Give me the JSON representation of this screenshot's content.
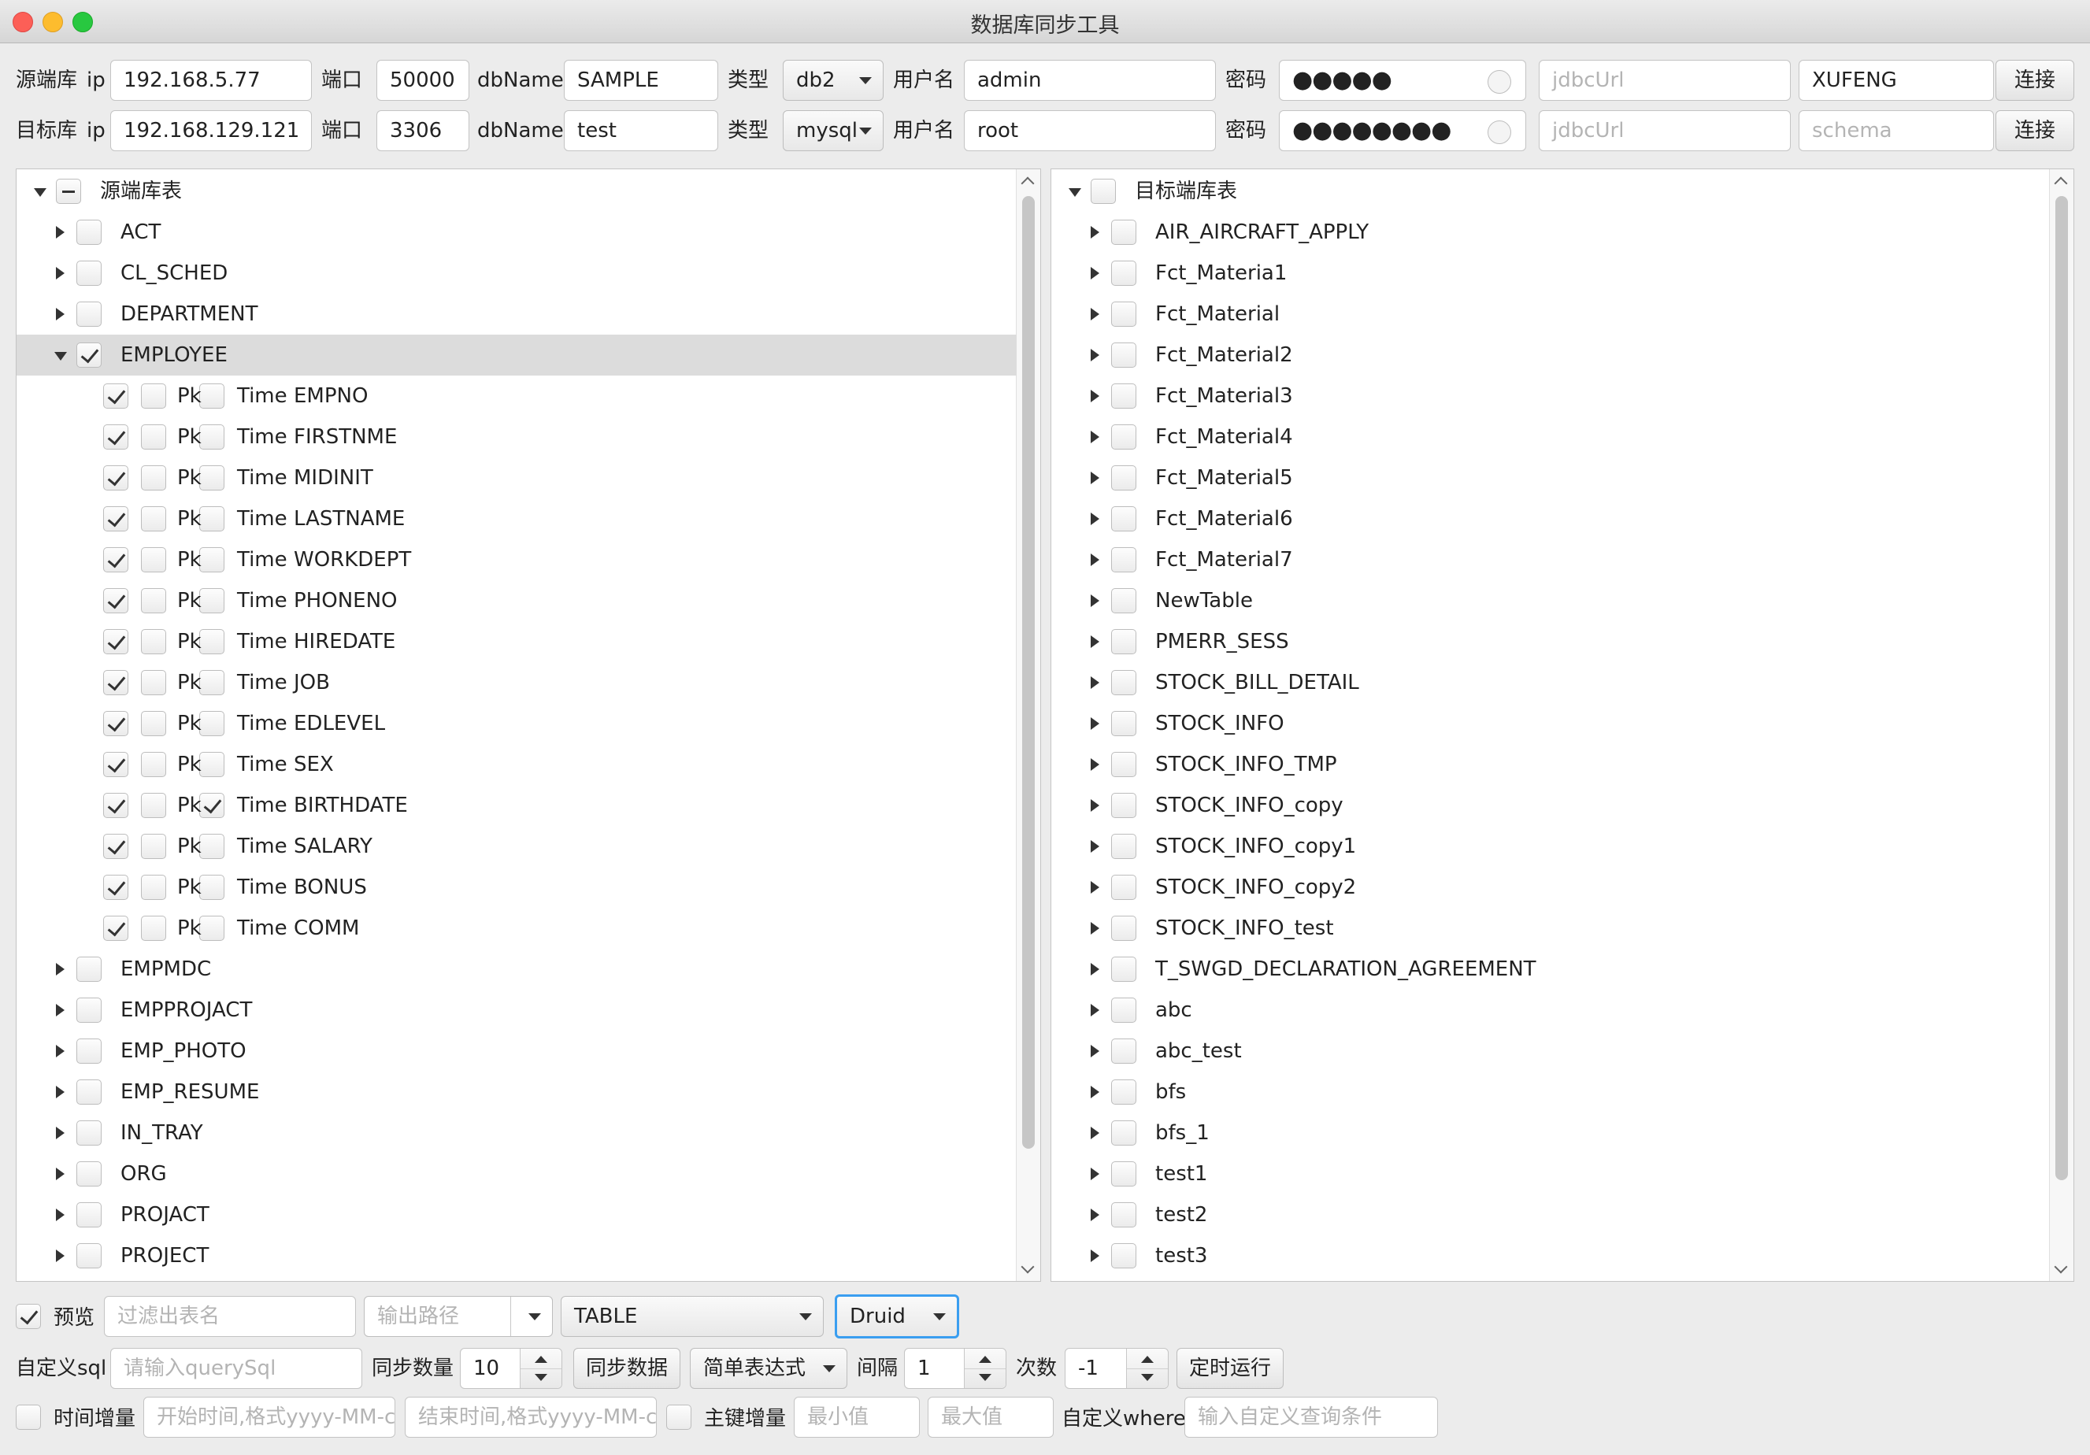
{
  "window": {
    "title": "数据库同步工具"
  },
  "source": {
    "label": "源端库",
    "ip_label": "ip",
    "ip": "192.168.5.77",
    "port_label": "端口",
    "port": "50000",
    "dbname_label": "dbName",
    "dbname": "SAMPLE",
    "type_label": "类型",
    "type": "db2",
    "user_label": "用户名",
    "user": "admin",
    "pwd_label": "密码",
    "pwd": "●●●●●",
    "jdbc_placeholder": "jdbcUrl",
    "schema": "XUFENG",
    "connect_label": "连接"
  },
  "target": {
    "label": "目标库",
    "ip_label": "ip",
    "ip": "192.168.129.121",
    "port_label": "端口",
    "port": "3306",
    "dbname_label": "dbName",
    "dbname": "test",
    "type_label": "类型",
    "type": "mysql",
    "user_label": "用户名",
    "user": "root",
    "pwd_label": "密码",
    "pwd": "●●●●●●●●",
    "jdbc_placeholder": "jdbcUrl",
    "schema_placeholder": "schema",
    "connect_label": "连接"
  },
  "source_tree": {
    "root_label": "源端库表",
    "tables_before": [
      "ACT",
      "CL_SCHED",
      "DEPARTMENT"
    ],
    "expanded_table": "EMPLOYEE",
    "column_pk_label": "Pk",
    "column_time_label": "Time",
    "columns": [
      {
        "name": "EMPNO",
        "time": false
      },
      {
        "name": "FIRSTNME",
        "time": false
      },
      {
        "name": "MIDINIT",
        "time": false
      },
      {
        "name": "LASTNAME",
        "time": false
      },
      {
        "name": "WORKDEPT",
        "time": false
      },
      {
        "name": "PHONENO",
        "time": false
      },
      {
        "name": "HIREDATE",
        "time": false
      },
      {
        "name": "JOB",
        "time": false
      },
      {
        "name": "EDLEVEL",
        "time": false
      },
      {
        "name": "SEX",
        "time": false
      },
      {
        "name": "BIRTHDATE",
        "time": true
      },
      {
        "name": "SALARY",
        "time": false
      },
      {
        "name": "BONUS",
        "time": false
      },
      {
        "name": "COMM",
        "time": false
      }
    ],
    "tables_after": [
      "EMPMDC",
      "EMPPROJACT",
      "EMP_PHOTO",
      "EMP_RESUME",
      "IN_TRAY",
      "ORG",
      "PROJACT",
      "PROJECT"
    ]
  },
  "target_tree": {
    "root_label": "目标端库表",
    "tables": [
      "AIR_AIRCRAFT_APPLY",
      "Fct_Materia1",
      "Fct_Material",
      "Fct_Material2",
      "Fct_Material3",
      "Fct_Material4",
      "Fct_Material5",
      "Fct_Material6",
      "Fct_Material7",
      "NewTable",
      "PMERR_SESS",
      "STOCK_BILL_DETAIL",
      "STOCK_INFO",
      "STOCK_INFO_TMP",
      "STOCK_INFO_copy",
      "STOCK_INFO_copy1",
      "STOCK_INFO_copy2",
      "STOCK_INFO_test",
      "T_SWGD_DECLARATION_AGREEMENT",
      "abc",
      "abc_test",
      "bfs",
      "bfs_1",
      "test1",
      "test2",
      "test3"
    ]
  },
  "bottom": {
    "preview_label": "预览",
    "filter_placeholder": "过滤出表名",
    "output_placeholder": "输出路径",
    "mode": "TABLE",
    "pool": "Druid",
    "custom_sql_label": "自定义sql",
    "sql_placeholder": "请输入querySql",
    "sync_count_label": "同步数量",
    "sync_count": "10",
    "sync_button": "同步数据",
    "expr_mode": "简单表达式",
    "interval_label": "间隔",
    "interval": "1",
    "times_label": "次数",
    "times": "-1",
    "schedule_button": "定时运行",
    "time_inc_label": "时间增量",
    "start_placeholder": "开始时间,格式yyyy-MM-c",
    "end_placeholder": "结束时间,格式yyyy-MM-c",
    "pk_inc_label": "主键增量",
    "min_placeholder": "最小值",
    "max_placeholder": "最大值",
    "custom_where_label": "自定义where",
    "where_placeholder": "输入自定义查询条件"
  }
}
